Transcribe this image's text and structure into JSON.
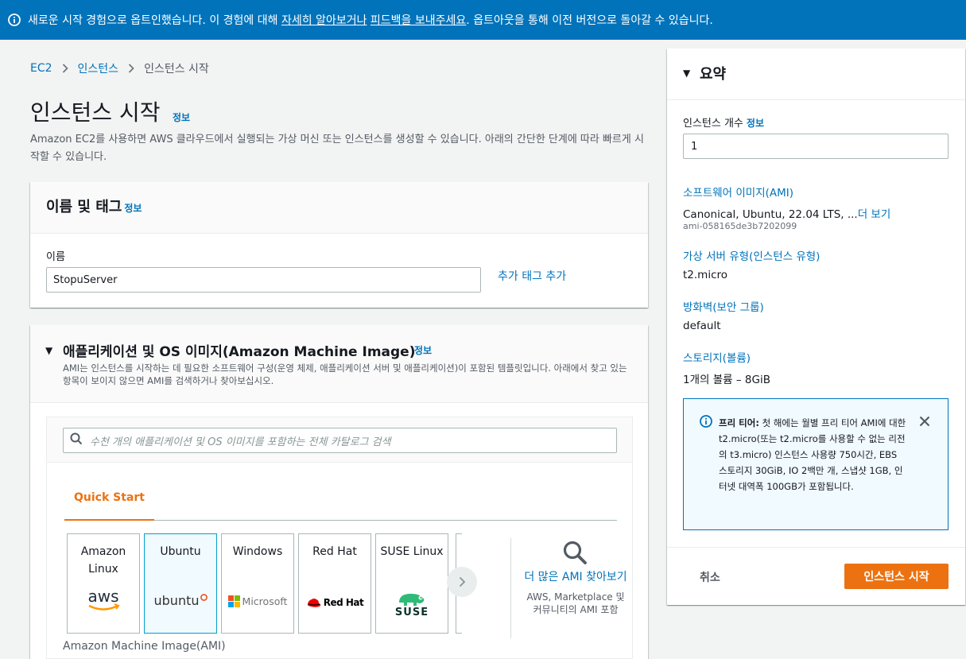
{
  "banner": {
    "text_before": "새로운 시작 경험으로 옵트인했습니다. 이 경험에 대해 ",
    "learn_more": "자세히 알아보거나",
    "text_mid": " ",
    "feedback": "피드백을 보내주세요",
    "text_after": ". 옵트아웃을 통해 이전 버전으로 돌아갈 수 있습니다."
  },
  "breadcrumb": {
    "items": [
      "EC2",
      "인스턴스",
      "인스턴스 시작"
    ]
  },
  "page": {
    "title": "인스턴스 시작",
    "info": "정보",
    "description": "Amazon EC2를 사용하면 AWS 클라우드에서 실행되는 가상 머신 또는 인스턴스를 생성할 수 있습니다. 아래의 간단한 단계에 따라 빠르게 시작할 수 있습니다."
  },
  "name_tags": {
    "title": "이름 및 태그",
    "info": "정보",
    "name_label": "이름",
    "name_value": "StopuServer",
    "add_tags": "추가 태그 추가"
  },
  "ami": {
    "title": "애플리케이션 및 OS 이미지(Amazon Machine Image)",
    "info": "정보",
    "description": "AMI는 인스턴스를 시작하는 데 필요한 소프트웨어 구성(운영 체제, 애플리케이션 서버 및 애플리케이션)이 포함된 템플릿입니다. 아래에서 찾고 있는 항목이 보이지 않으면 AMI를 검색하거나 찾아보십시오.",
    "search_placeholder": "수천 개의 애플리케이션 및 OS 이미지를 포함하는 전체 카탈로그 검색",
    "tab_quick_start": "Quick Start",
    "cards": [
      {
        "name": "Amazon Linux",
        "logo": "aws"
      },
      {
        "name": "Ubuntu",
        "logo": "ubuntu"
      },
      {
        "name": "Windows",
        "logo": "Microsoft"
      },
      {
        "name": "Red Hat",
        "logo": "Red Hat"
      },
      {
        "name": "SUSE Linux",
        "logo": "SUSE"
      }
    ],
    "browse_more": "더 많은 AMI 찾아보기",
    "browse_sub": "AWS, Marketplace 및 커뮤니티의 AMI 포함",
    "caption": "Amazon Machine Image(AMI)"
  },
  "summary": {
    "title": "요약",
    "instance_count_label": "인스턴스 개수",
    "info": "정보",
    "instance_count": "1",
    "ami_label": "소프트웨어 이미지(AMI)",
    "ami_value": "Canonical, Ubuntu, 22.04 LTS, ...",
    "ami_more": "더 보기",
    "ami_id": "ami-058165de3b7202099",
    "type_label": "가상 서버 유형(인스턴스 유형)",
    "type_value": "t2.micro",
    "firewall_label": "방화벽(보안 그룹)",
    "firewall_value": "default",
    "storage_label": "스토리지(볼륨)",
    "storage_value": "1개의 볼륨 – 8GiB",
    "free_tier_bold": "프리 티어:",
    "free_tier_text": " 첫 해에는 월별 프리 티어 AMI에 대한 t2.micro(또는 t2.micro를 사용할 수 없는 리전의 t3.micro) 인스턴스 사용량 750시간, EBS 스토리지 30GiB, IO 2백만 개, 스냅샷 1GB, 인터넷 대역폭 100GB가 포함됩니다.",
    "cancel": "취소",
    "launch": "인스턴스 시작"
  },
  "colors": {
    "primary": "#0073bb",
    "accent": "#ec7211",
    "background": "#f2f3f3"
  }
}
